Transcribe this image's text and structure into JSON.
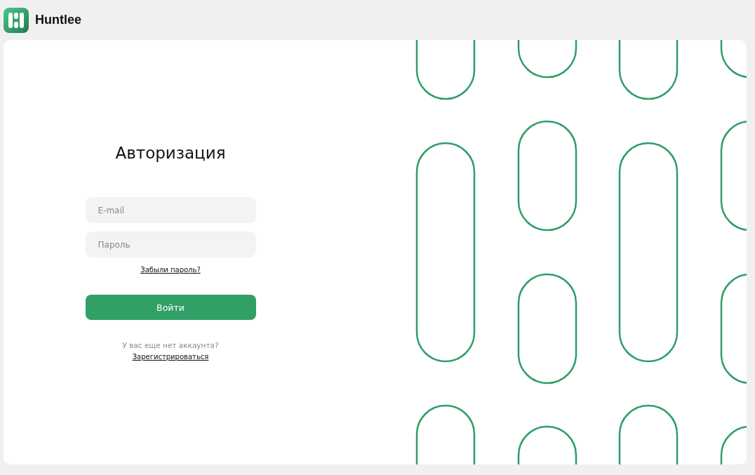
{
  "header": {
    "brand": "Huntlee"
  },
  "login_form": {
    "title": "Авторизация",
    "fields": [
      {
        "placeholder": "E-mail"
      },
      {
        "placeholder": "Пароль"
      }
    ],
    "forgot_link": "Забыли пароль?",
    "submit_button": "Войти",
    "signup_prompt": "У вас еще нет аккаунта?",
    "signup_link": "Зарегистрироваться"
  }
}
